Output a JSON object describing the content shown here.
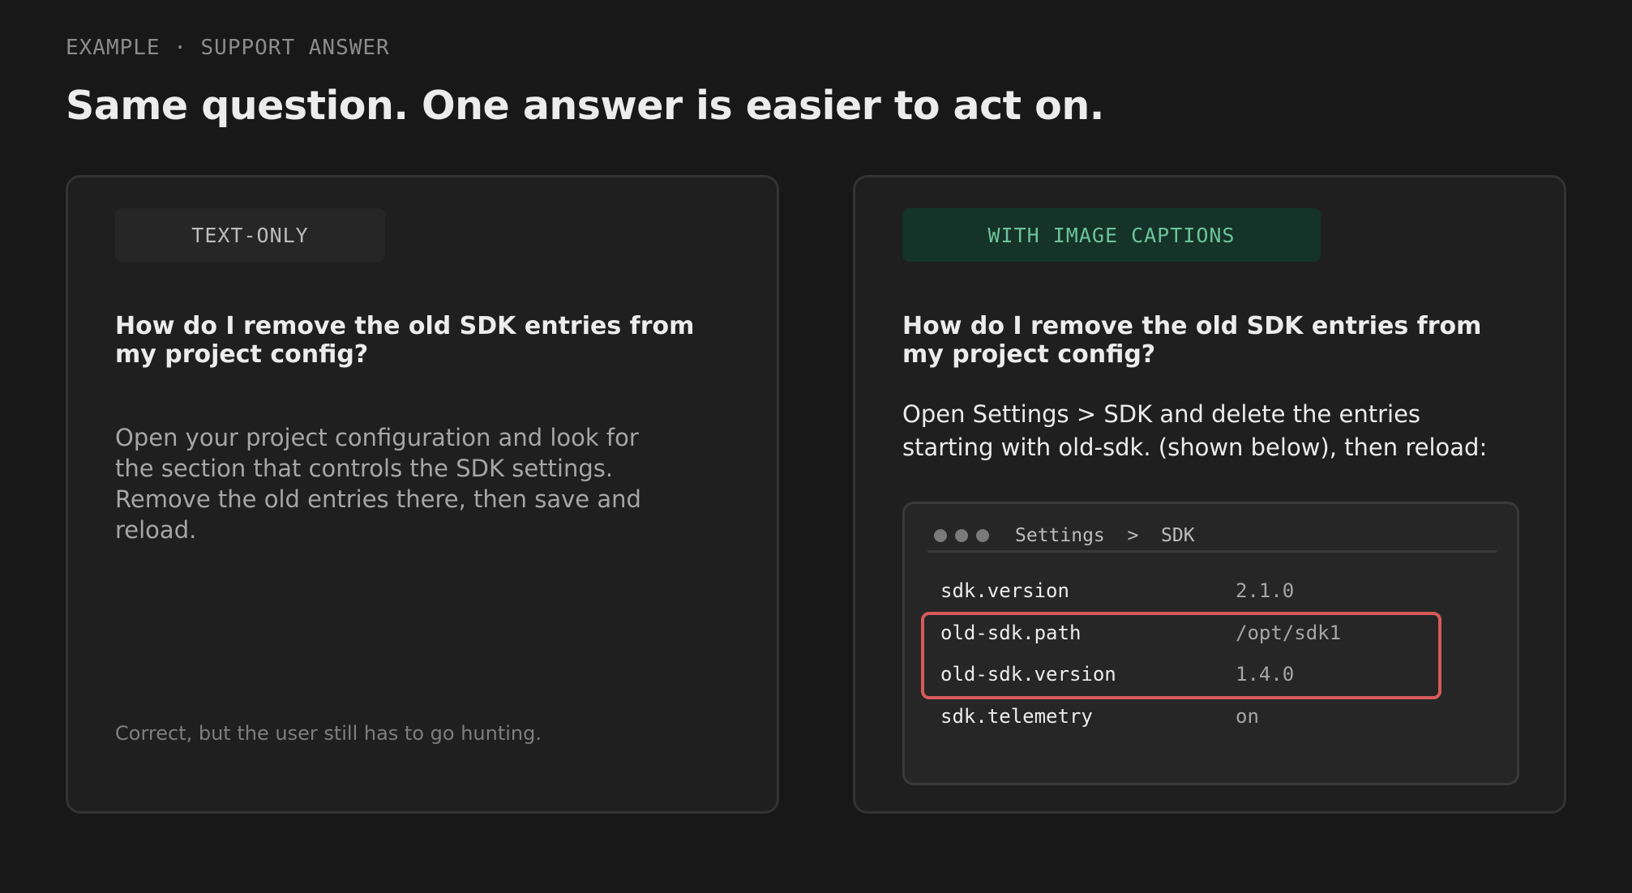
{
  "eyebrow": "EXAMPLE · SUPPORT ANSWER",
  "headline": "Same question. One answer is easier to act on.",
  "left_card": {
    "badge": "TEXT-ONLY",
    "question": "How do I remove the old SDK entries from my project config?",
    "answer": "Open your project configuration and look for the section that controls the SDK settings. Remove the old entries there, then save and reload.",
    "footnote": "Correct, but the user still has to go hunting."
  },
  "right_card": {
    "badge": "WITH IMAGE CAPTIONS",
    "question": "How do I remove the old SDK entries from my project config?",
    "answer": "Open Settings > SDK and delete the entries starting with old-sdk. (shown below), then reload:",
    "screenshot": {
      "breadcrumb": "Settings  >  SDK",
      "rows": [
        {
          "key": "sdk.version",
          "value": "2.1.0"
        },
        {
          "key": "old-sdk.path",
          "value": "/opt/sdk1"
        },
        {
          "key": "old-sdk.version",
          "value": "1.4.0"
        },
        {
          "key": "sdk.telemetry",
          "value": "on"
        }
      ],
      "highlight_color": "#d65a58"
    }
  },
  "colors": {
    "background": "#181818",
    "card": "#1f1f1f",
    "accent_green": "#6cc39c",
    "accent_green_bg": "#153328",
    "highlight_red": "#d65a58"
  }
}
